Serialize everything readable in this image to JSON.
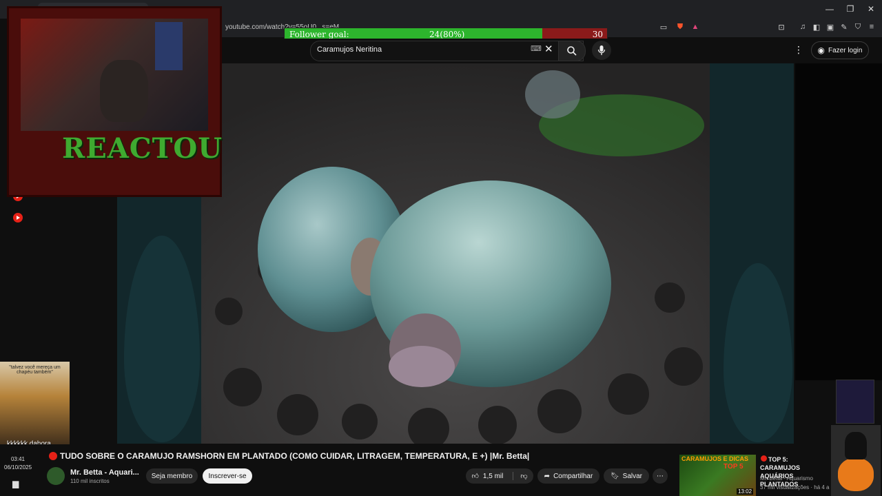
{
  "browser": {
    "url": "youtube.com/watch?v=55oU0...s=eM",
    "window_controls": {
      "minimize": "—",
      "maximize": "❐",
      "close": "✕"
    }
  },
  "follower_goal": {
    "label": "Follower goal:",
    "count_text": "24(80%)",
    "target": "30",
    "progress": 0.8,
    "colors": {
      "fill": "#2db52d",
      "remaining": "#8b1a1a"
    }
  },
  "youtube": {
    "search": {
      "query": "Caramujos Neritina"
    },
    "login_label": "Fazer login",
    "video": {
      "title": "TUDO SOBRE O CARAMUJO RAMSHORN EM PLANTADO (COMO CUIDAR, LITRAGEM, TEMPERATURA, E +) |Mr. Betta|",
      "channel": "Mr. Betta - Aquari...",
      "subscribers": "110 mil inscritos",
      "member_label": "Seja membro",
      "subscribe_label": "Inscrever-se",
      "likes": "1,5 mil",
      "share_label": "Compartilhar",
      "save_label": "Salvar"
    },
    "related": {
      "thumb_text": "CARAMUJOS E DICAS",
      "thumb_badge": "TOP 5",
      "duration": "13:02",
      "title": "TOP 5: CARAMUJOS AQUÁRIOS PLANTADOS",
      "channel": "Mr. Betta - Aquarismo",
      "stats": "37 mil visualizações · há 4 a"
    }
  },
  "overlay": {
    "reactou": "REACTOU",
    "meme_text": "\"talvez você mereça um chapéu também\"",
    "meme_caption": "kkkkkk dahora"
  },
  "taskbar": {
    "time": "03:41",
    "date": "06/10/2025"
  }
}
